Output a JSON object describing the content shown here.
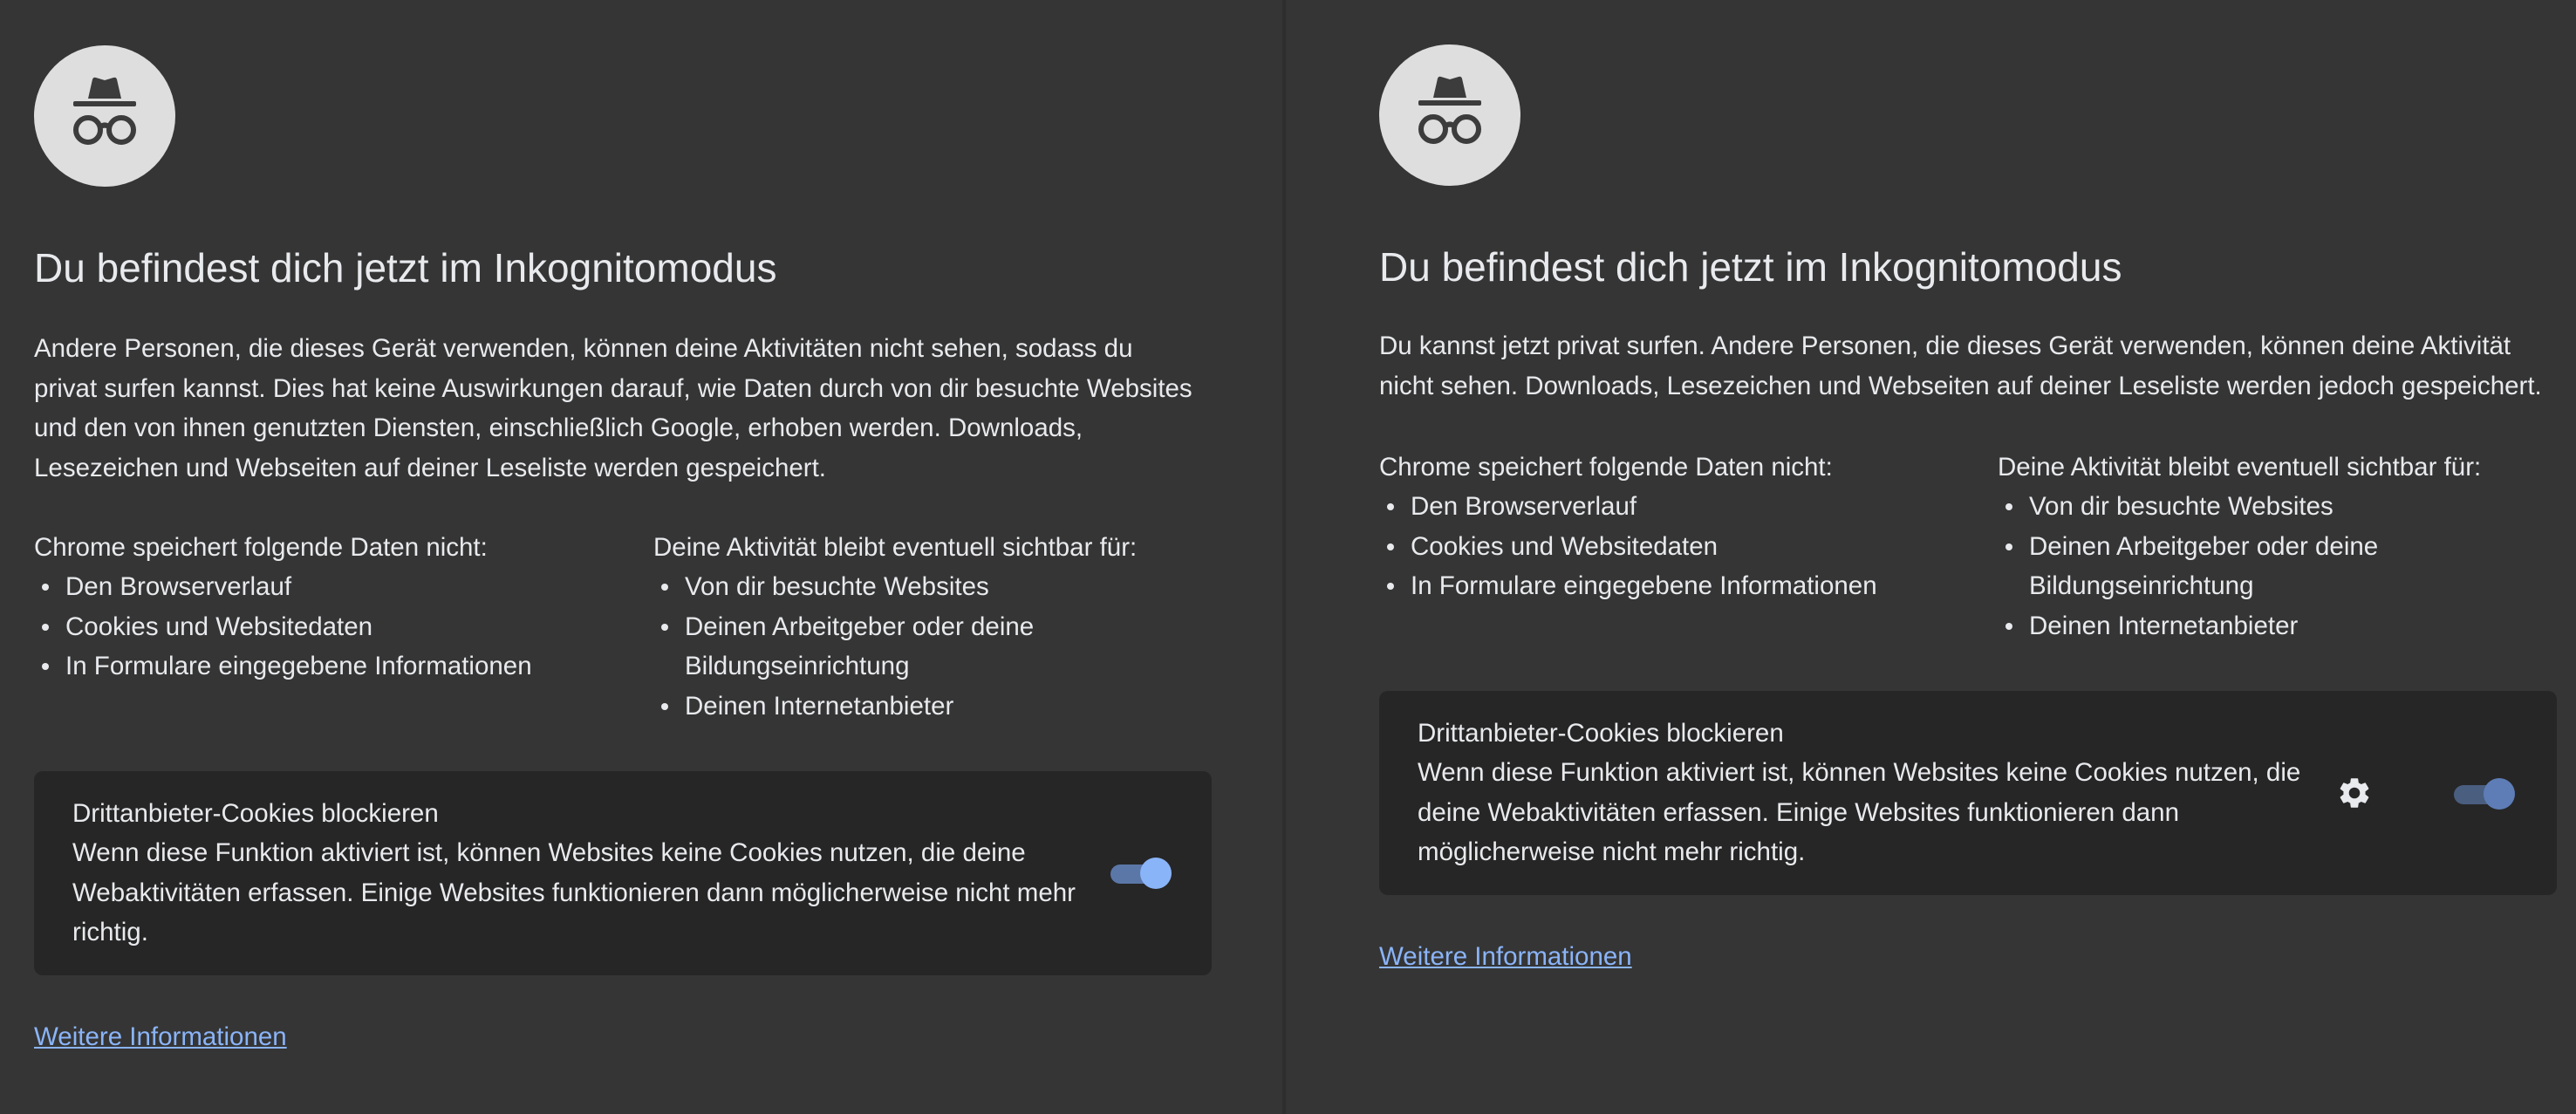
{
  "left": {
    "title": "Du befindest dich jetzt im Inkognitomodus",
    "intro": "Andere Personen, die dieses Gerät verwenden, können deine Aktivitäten nicht sehen, sodass du privat surfen kannst. Dies hat keine Auswirkungen darauf, wie Daten durch von dir besuchte Websites und den von ihnen genutzten Diensten, einschließlich Google, erhoben werden. Downloads, Lesezeichen und Webseiten auf deiner Leseliste werden gespeichert.",
    "not_saved_heading": "Chrome speichert folgende Daten nicht:",
    "not_saved_items": [
      "Den Browserverlauf",
      "Cookies und Websitedaten",
      "In Formulare eingegebene Informationen"
    ],
    "visible_heading": "Deine Aktivität bleibt eventuell sichtbar für:",
    "visible_items": [
      "Von dir besuchte Websites",
      "Deinen Arbeitgeber oder deine Bildungseinrichtung",
      "Deinen Internetanbieter"
    ],
    "cookie_title": "Drittanbieter-Cookies blockieren",
    "cookie_desc": "Wenn diese Funktion aktiviert ist, können Websites keine Cookies nutzen, die deine Webaktivitäten erfassen. Einige Websites funktionieren dann möglicherweise nicht mehr richtig.",
    "cookie_toggle_on": true,
    "learn_more": "Weitere Informationen"
  },
  "right": {
    "title": "Du befindest dich jetzt im Inkognitomodus",
    "intro": "Du kannst jetzt privat surfen. Andere Personen, die dieses Gerät verwenden, können deine Aktivität nicht sehen. Downloads, Lesezeichen und Webseiten auf deiner Leseliste werden jedoch gespeichert.",
    "not_saved_heading": "Chrome speichert folgende Daten nicht:",
    "not_saved_items": [
      "Den Browserverlauf",
      "Cookies und Websitedaten",
      "In Formulare eingegebene Informationen"
    ],
    "visible_heading": "Deine Aktivität bleibt eventuell sichtbar für:",
    "visible_items": [
      "Von dir besuchte Websites",
      "Deinen Arbeitgeber oder deine Bildungseinrichtung",
      "Deinen Internetanbieter"
    ],
    "cookie_title": "Drittanbieter-Cookies blockieren",
    "cookie_desc": "Wenn diese Funktion aktiviert ist, können Websites keine Cookies nutzen, die deine Webaktivitäten erfassen. Einige Websites funktionieren dann möglicherweise nicht mehr richtig.",
    "cookie_toggle_on": true,
    "learn_more": "Weitere Informationen"
  },
  "icons": {
    "logo": "incognito-icon",
    "settings": "gear-icon"
  },
  "colors": {
    "background": "#353535",
    "card": "#262626",
    "text": "#e8eaed",
    "link": "#8ab4f8",
    "logo_circle": "#dedede",
    "logo_glyph": "#3c3c3c"
  }
}
